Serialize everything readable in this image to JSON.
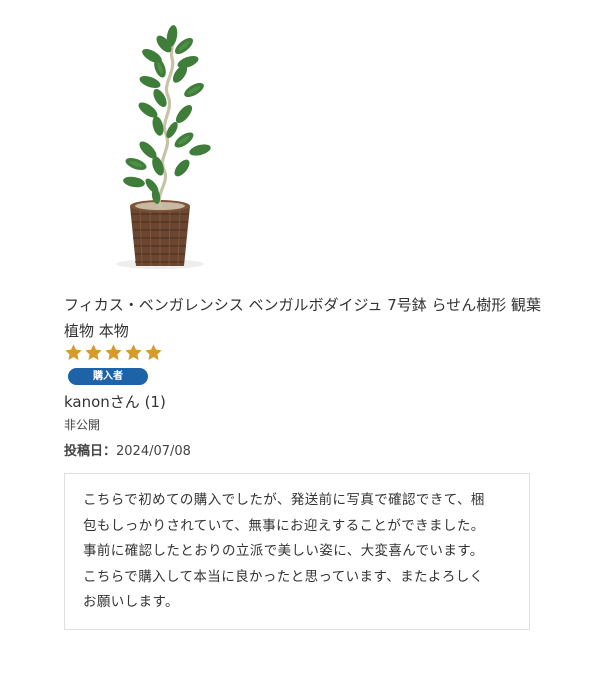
{
  "product": {
    "title": "フィカス・ベンガレンシス ベンガルボダイジュ 7号鉢 らせん樹形 観葉植物 本物",
    "image_icon": "potted-plant-image"
  },
  "review": {
    "rating": 5,
    "rating_max": 5,
    "star_color": "#d69a2d",
    "badge_label": "購入者",
    "badge_color": "#1e63a8",
    "reviewer_name": "kanonさん (1)",
    "age": "非公開",
    "date_label": "投稿日：",
    "date_value": "2024/07/08",
    "body": "こちらで初めての購入でしたが、発送前に写真で確認できて、梱\n包もしっかりされていて、無事にお迎えすることができました。\n事前に確認したとおりの立派で美しい姿に、大変喜んでいます。\nこちらで購入して本当に良かったと思っています、またよろしく\nお願いします。"
  }
}
